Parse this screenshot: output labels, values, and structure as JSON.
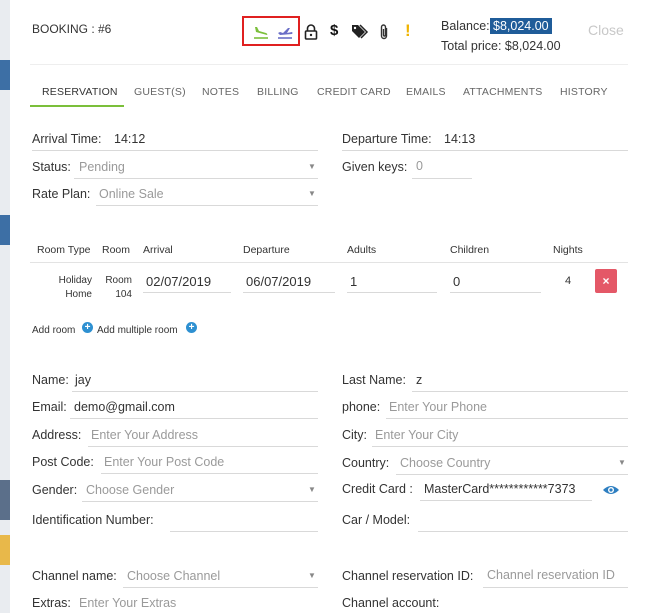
{
  "header": {
    "booking_label": "BOOKING : #6",
    "balance_label": "Balance:",
    "balance_value": "$8,024.00",
    "total_label": "Total price: $8,024.00",
    "close_label": "Close"
  },
  "toolbar_icons": [
    "arrival-plane-icon",
    "departure-plane-icon",
    "lock-icon",
    "dollar-icon",
    "tags-icon",
    "paperclip-icon",
    "exclamation-icon"
  ],
  "colors": {
    "accent": "#7bbf3a",
    "balance_bg": "#1f5c99",
    "delete_btn": "#e45867",
    "add_icon": "#2e90d1",
    "highlight_box": "#e02020"
  },
  "tabs": [
    "RESERVATION",
    "GUEST(S)",
    "NOTES",
    "BILLING",
    "CREDIT CARD",
    "EMAILS",
    "ATTACHMENTS",
    "HISTORY"
  ],
  "reservation": {
    "arrival_time_label": "Arrival Time:",
    "arrival_time": "14:12",
    "departure_time_label": "Departure Time:",
    "departure_time": "14:13",
    "status_label": "Status:",
    "status_value": "Pending",
    "given_keys_label": "Given keys:",
    "given_keys_value": "0",
    "rate_plan_label": "Rate Plan:",
    "rate_plan_value": "Online Sale"
  },
  "rooms_table": {
    "headers": [
      "Room Type",
      "Room",
      "Arrival",
      "Departure",
      "Adults",
      "Children",
      "Nights"
    ],
    "row": {
      "room_type_line1": "Holiday",
      "room_type_line2": "Home",
      "room_line1": "Room",
      "room_line2": "104",
      "arrival": "02/07/2019",
      "departure": "06/07/2019",
      "adults": "1",
      "children": "0",
      "nights": "4",
      "delete_symbol": "×"
    },
    "add_room_label": "Add room",
    "add_multiple_label": "Add multiple room"
  },
  "guest": {
    "name_label": "Name:",
    "name_value": "jay",
    "last_name_label": "Last Name:",
    "last_name_value": "z",
    "email_label": "Email:",
    "email_value": "demo@gmail.com",
    "phone_label": "phone:",
    "phone_placeholder": "Enter Your Phone",
    "address_label": "Address:",
    "address_placeholder": "Enter Your Address",
    "city_label": "City:",
    "city_placeholder": "Enter Your City",
    "post_code_label": "Post Code:",
    "post_code_placeholder": "Enter Your Post Code",
    "country_label": "Country:",
    "country_placeholder": "Choose Country",
    "gender_label": "Gender:",
    "gender_placeholder": "Choose Gender",
    "credit_card_label": "Credit Card :",
    "credit_card_value": "MasterCard************7373",
    "id_number_label": "Identification Number:",
    "car_label": "Car / Model:"
  },
  "channel": {
    "channel_name_label": "Channel name:",
    "channel_name_placeholder": "Choose Channel",
    "channel_res_id_label": "Channel reservation ID:",
    "channel_res_id_placeholder": "Channel reservation ID",
    "extras_label": "Extras:",
    "extras_placeholder": "Enter Your Extras",
    "channel_account_label": "Channel account:"
  }
}
